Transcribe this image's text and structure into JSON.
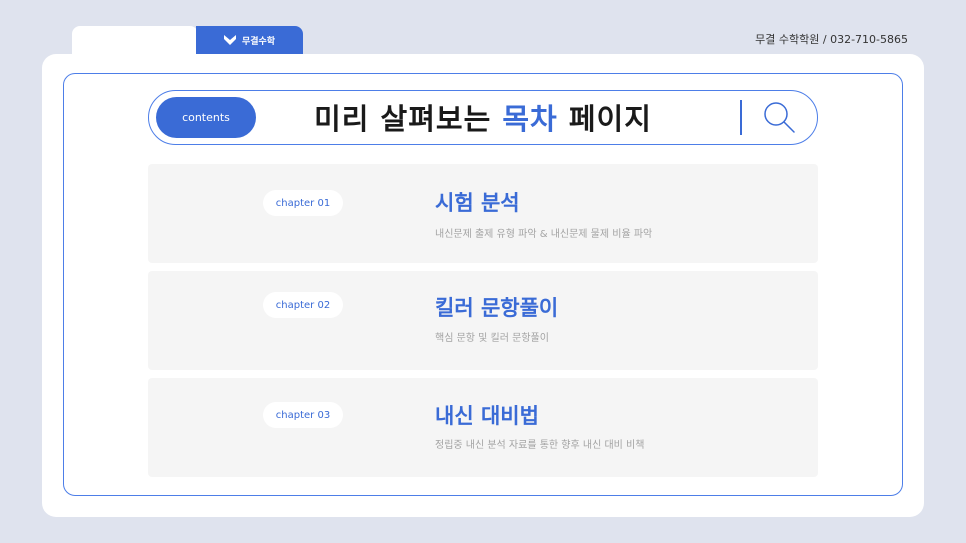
{
  "header": {
    "tab_label": "무결수학",
    "contact": "무결 수학학원  /  032-710-5865"
  },
  "search": {
    "pill_label": "contents",
    "title_prefix": "미리 살펴보는 ",
    "title_highlight": "목차",
    "title_suffix": " 페이지"
  },
  "chapters": [
    {
      "tag": "chapter 01",
      "title": "시험 분석",
      "desc": "내신문제 출제 유형 파악 & 내신문제 물제 비율 파악"
    },
    {
      "tag": "chapter 02",
      "title": "킬러 문항풀이",
      "desc": "핵심 문항 및 킬러 문항풀이"
    },
    {
      "tag": "chapter 03",
      "title": "내신 대비법",
      "desc": "정립중 내신 분석 자료를 통한 향후 내신 대비 비책"
    }
  ],
  "colors": {
    "accent": "#3a6bd6",
    "background": "#dfe3ee"
  },
  "icons": {
    "tab": "chevron-down-icon",
    "search": "search-icon"
  }
}
